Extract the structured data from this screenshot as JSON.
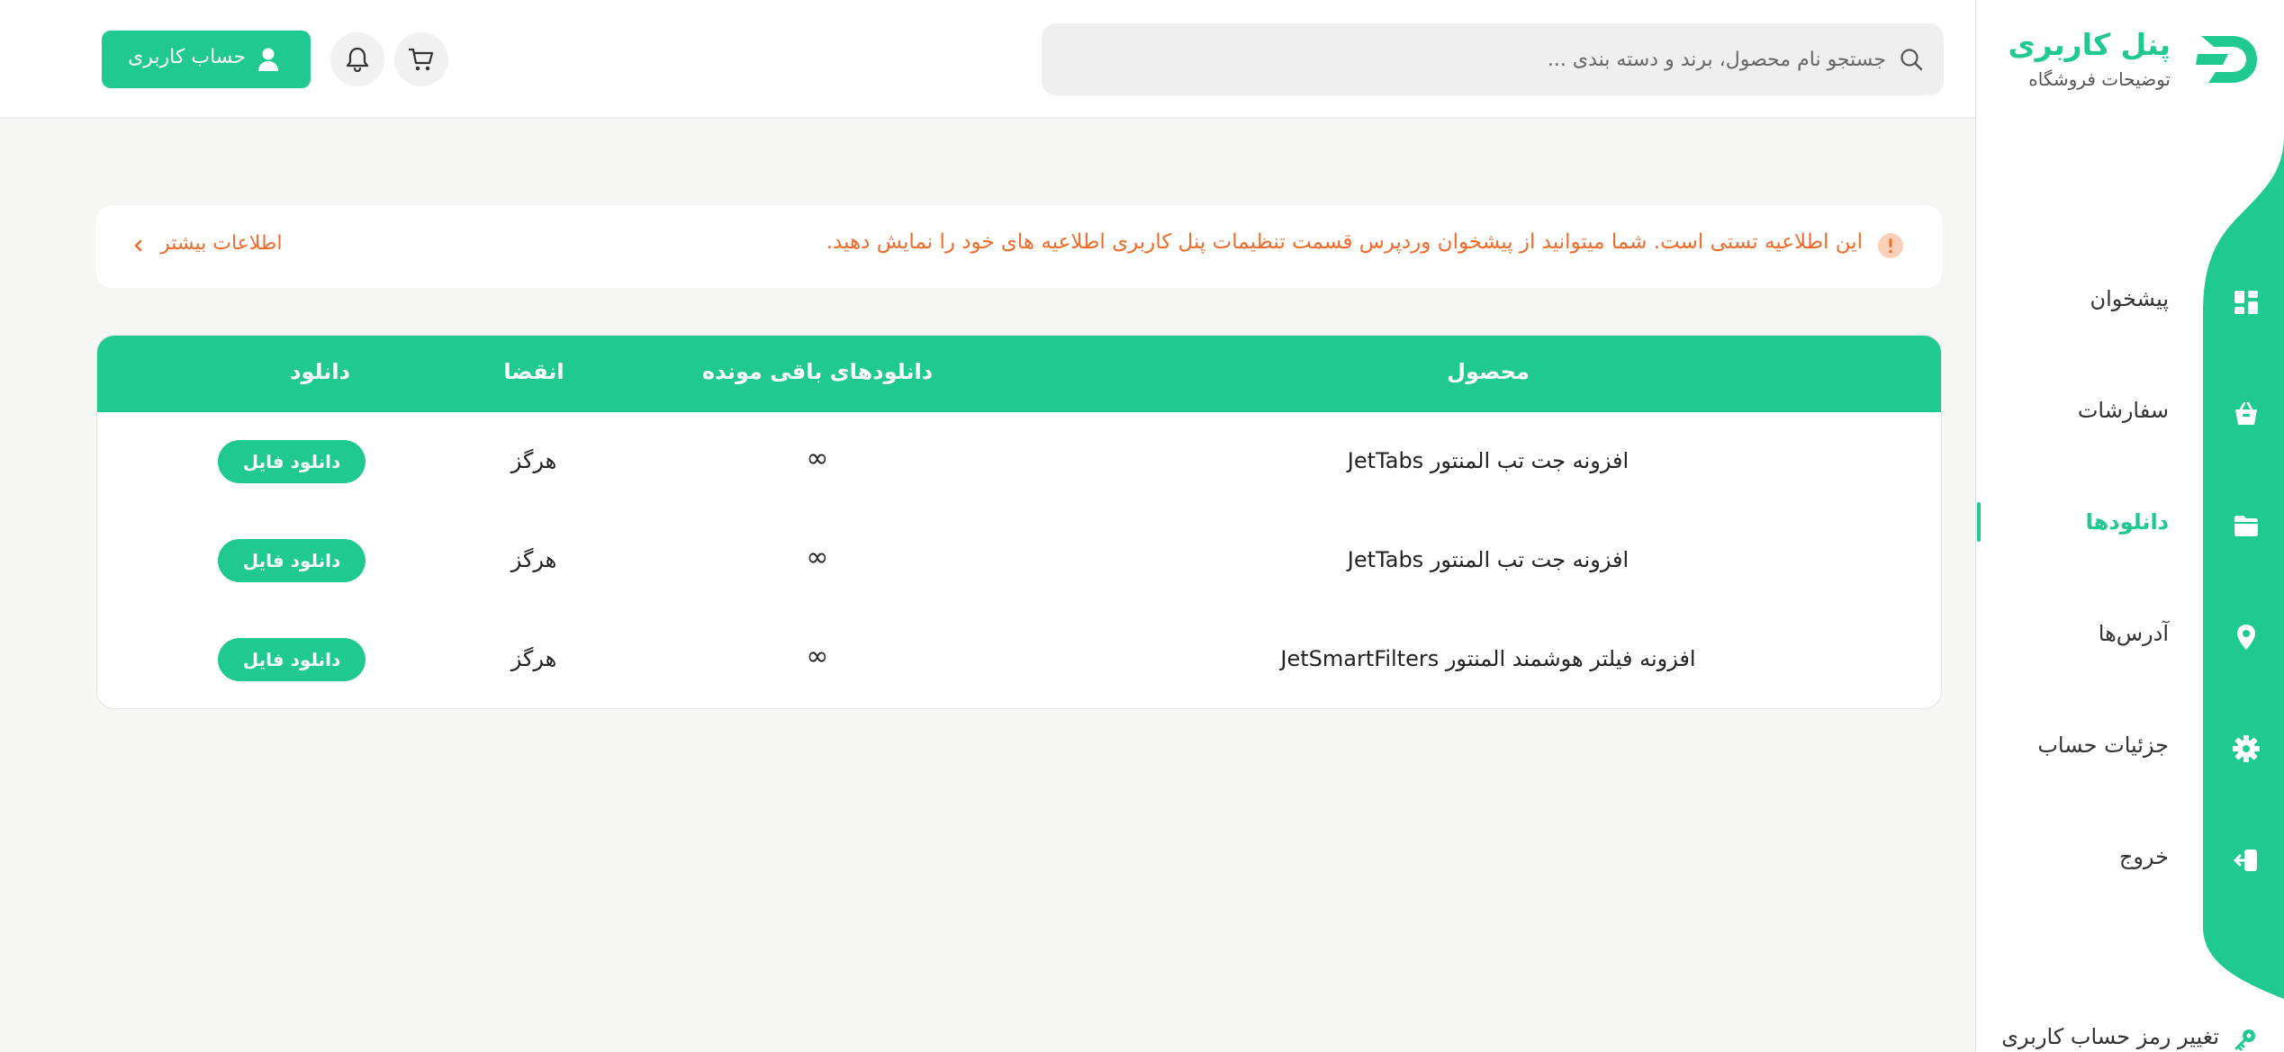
{
  "sidebar": {
    "brand_title": "پنل کاربری",
    "brand_subtitle": "توضیحات فروشگاه",
    "items": [
      {
        "label": "پیشخوان",
        "icon": "dashboard-icon"
      },
      {
        "label": "سفارشات",
        "icon": "basket-icon"
      },
      {
        "label": "دانلودها",
        "icon": "folder-icon"
      },
      {
        "label": "آدرس‌ها",
        "icon": "location-pin-icon"
      },
      {
        "label": "جزئیات حساب",
        "icon": "gear-icon"
      },
      {
        "label": "خروج",
        "icon": "logout-icon"
      }
    ],
    "active_item": "دانلودها",
    "change_password_label": "تغییر رمز حساب کاربری"
  },
  "header": {
    "search_placeholder": "جستجو نام محصول، برند و دسته بندی ...",
    "account_label": "حساب کاربری"
  },
  "notice": {
    "text": "این اطلاعیه تستی است. شما میتوانید از پیشخوان وردپرس قسمت تنظیمات پنل کاربری اطلاعیه های خود را نمایش دهید.",
    "more_label": "اطلاعات بیشتر"
  },
  "downloads": {
    "columns": [
      "محصول",
      "دانلودهای باقی مونده",
      "انقضا",
      "دانلود"
    ],
    "rows": [
      {
        "product": "افزونه جت تب المنتور JetTabs",
        "remaining": "∞",
        "expires": "هرگز",
        "button": "دانلود فایل"
      },
      {
        "product": "افزونه جت تب المنتور JetTabs",
        "remaining": "∞",
        "expires": "هرگز",
        "button": "دانلود فایل"
      },
      {
        "product": "افزونه فیلتر هوشمند المنتور JetSmartFilters",
        "remaining": "∞",
        "expires": "هرگز",
        "button": "دانلود فایل"
      }
    ]
  },
  "colors": {
    "accent": "#20c98f",
    "notice": "#f06c2c",
    "background": "#f6f6f4"
  }
}
